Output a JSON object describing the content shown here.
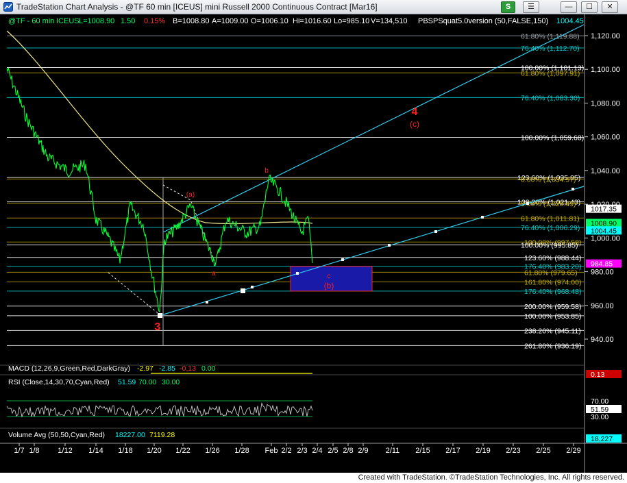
{
  "window": {
    "title": "TradeStation Chart Analysis - @TF 60 min [ICEUS] mini Russell 2000 Continuous Contract [Mar16]",
    "buttons": {
      "strategy": "S",
      "menu": "☰",
      "minimize": "—",
      "maximize": "☐",
      "close": "✕"
    }
  },
  "header": {
    "symbol": "@TF - 60 min",
    "exchange": "ICEUS",
    "last": "L=1008.90",
    "change": "1.50",
    "pct": "0.15%",
    "bid": "B=1008.80",
    "ask": "A=1009.00",
    "open": "O=1006.10",
    "high": "Hi=1016.60",
    "low": "Lo=985.10",
    "volume": "V=134,510",
    "study": "PBSPSquat5.0version (50,FALSE,150)",
    "study_value": "1004.45"
  },
  "price_axis": {
    "ticks": [
      "1,120.00",
      "1,100.00",
      "1,080.00",
      "1,060.00",
      "1,040.00",
      "1,020.00",
      "1,000.00",
      "980.00",
      "960.00",
      "940.00"
    ]
  },
  "date_axis": {
    "ticks": [
      "1/7",
      "1/8",
      "1/12",
      "1/14",
      "1/18",
      "1/20",
      "1/22",
      "1/26",
      "1/28",
      "Feb",
      "2/2",
      "2/3",
      "2/4",
      "2/5",
      "2/8",
      "2/9",
      "2/11",
      "2/15",
      "2/17",
      "2/19",
      "2/23",
      "2/25",
      "2/29"
    ]
  },
  "price_tags": [
    {
      "value": "1017.35",
      "bg": "#ffffff",
      "fg": "#000000"
    },
    {
      "value": "1008.90",
      "bg": "#00ff66",
      "fg": "#000000"
    },
    {
      "value": "1004.45",
      "bg": "#00ffff",
      "fg": "#000000"
    },
    {
      "value": "984.85",
      "bg": "#ff00ff",
      "fg": "#ffffff"
    }
  ],
  "fib_levels": [
    {
      "label": "61.80% (1,119.88)",
      "price": 1119.88,
      "color": "#9aa0a6"
    },
    {
      "label": "76.40% (1,112.70)",
      "price": 1112.7,
      "color": "#00cfcf"
    },
    {
      "label": "100.00% (1,101.13)",
      "price": 1101.13,
      "color": "#ffffff"
    },
    {
      "label": "61.80% (1,097.91)",
      "price": 1097.91,
      "color": "#b8a000"
    },
    {
      "label": "76.40% (1,083.30)",
      "price": 1083.3,
      "color": "#00cfcf"
    },
    {
      "label": "100.00% (1,059.68)",
      "price": 1059.68,
      "color": "#ffffff"
    },
    {
      "label": "123.60% (1,035.85)",
      "price": 1035.85,
      "color": "#ffffff"
    },
    {
      "label": "0.00% (1,034.97)",
      "price": 1034.97,
      "color": "#b8a000"
    },
    {
      "label": "138.20% (1,021.43)",
      "price": 1021.43,
      "color": "#ffffff"
    },
    {
      "label": "0.00% (1,020.49)",
      "price": 1020.49,
      "color": "#b8a000"
    },
    {
      "label": "61.80% (1,011.81)",
      "price": 1011.81,
      "color": "#b8a000"
    },
    {
      "label": "76.40% (1,006.29)",
      "price": 1006.29,
      "color": "#00cfcf"
    },
    {
      "label": "100.00% (997.58)",
      "price": 997.58,
      "color": "#b8a000"
    },
    {
      "label": "100.00% (995.85)",
      "price": 995.85,
      "color": "#ffffff"
    },
    {
      "label": "123.60% (988.44)",
      "price": 988.44,
      "color": "#ffffff"
    },
    {
      "label": "176.40% (983.20)",
      "price": 983.2,
      "color": "#00cfcf"
    },
    {
      "label": "61.80% (979.65)",
      "price": 979.65,
      "color": "#b8a000"
    },
    {
      "label": "161.80% (974.00)",
      "price": 974.0,
      "color": "#b8a000"
    },
    {
      "label": "176.40% (968.48)",
      "price": 968.48,
      "color": "#00cfcf"
    },
    {
      "label": "200.00% (959.58)",
      "price": 959.58,
      "color": "#ffffff"
    },
    {
      "label": "100.00% (953.85)",
      "price": 953.85,
      "color": "#ffffff"
    },
    {
      "label": "238.20% (945.11)",
      "price": 945.11,
      "color": "#ffffff"
    },
    {
      "label": "261.80% (936.19)",
      "price": 936.19,
      "color": "#ffffff"
    }
  ],
  "wave_labels": [
    {
      "text": "4",
      "color": "#ff2020"
    },
    {
      "text": "(c)",
      "color": "#ff2020"
    },
    {
      "text": "b",
      "color": "#ff2020"
    },
    {
      "text": "(a)",
      "color": "#ff2020"
    },
    {
      "text": "a",
      "color": "#ff2020"
    },
    {
      "text": "c",
      "color": "#ff2020"
    },
    {
      "text": "(b)",
      "color": "#ff2020"
    },
    {
      "text": "3",
      "color": "#ff2020"
    }
  ],
  "macd": {
    "title": "MACD (12,26,9,Green,Red,DarkGray)",
    "values": [
      "-2.97",
      "-2.85",
      "-0.13",
      "0.00"
    ],
    "colors": [
      "#ffff00",
      "#00ffff",
      "#ff3030",
      "#00ff66"
    ],
    "tag": "0.13"
  },
  "rsi": {
    "title": "RSI (Close,14,30,70,Cyan,Red)",
    "values": [
      "51.59",
      "70.00",
      "30.00"
    ],
    "colors": [
      "#00ffff",
      "#00ff66",
      "#00ff66"
    ],
    "axis": [
      "70.00",
      "51.59",
      "30.00"
    ]
  },
  "volume": {
    "title": "Volume Avg (50,50,Cyan,Red)",
    "values": [
      "18227.00",
      "7119.28"
    ],
    "colors": [
      "#00ffff",
      "#ffff00"
    ],
    "tag": "18,227"
  },
  "footer": {
    "text": "Created with TradeStation. ©TradeStation Technologies, Inc. All rights reserved."
  },
  "colors": {
    "price_line": "#00ff33",
    "moving_avg": "#f0e68c",
    "channel": "#33ccee",
    "target_box": "#1a1aa8"
  },
  "chart_data": {
    "type": "line",
    "symbol": "@TF 60 min",
    "x": [
      "1/7",
      "1/8",
      "1/12",
      "1/14",
      "1/18",
      "1/20",
      "1/22",
      "1/26",
      "1/28",
      "Feb",
      "2/2",
      "2/3"
    ],
    "series": [
      {
        "name": "",
        "values": [
          1097,
          1070,
          1046,
          1008,
          990,
          956,
          1015,
          988,
          1008,
          1034,
          1010,
          1004.45
        ]
      }
    ],
    "ylim": [
      930,
      1130
    ],
    "swing_points": [
      {
        "label": "3",
        "x": "1/20",
        "y": 953.85
      },
      {
        "label": "(a)",
        "x": "1/22",
        "y": 1020.5
      },
      {
        "label": "a",
        "x": "1/26",
        "y": 985.5
      },
      {
        "label": "b",
        "x": "Feb",
        "y": 1035
      },
      {
        "label": "c",
        "x": "2/3",
        "y": 984.85
      }
    ]
  }
}
